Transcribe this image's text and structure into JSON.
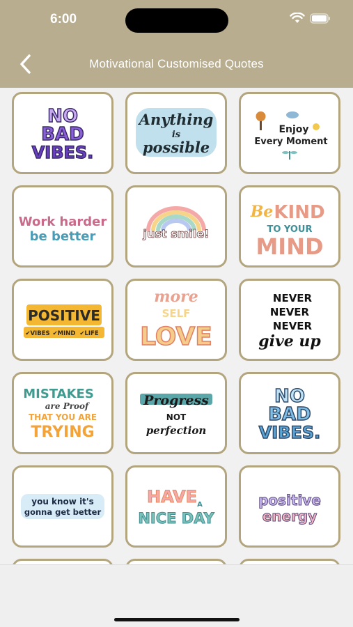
{
  "status_bar": {
    "time": "6:00"
  },
  "header": {
    "title": "Motivational Customised Quotes",
    "back_icon": "chevron-left-icon"
  },
  "stickers": [
    {
      "lines": [
        "NO",
        "BAD",
        "VIBES."
      ]
    },
    {
      "lines": [
        "Anything",
        "is",
        "possible"
      ]
    },
    {
      "lines": [
        "Enjoy",
        "Every Moment"
      ]
    },
    {
      "lines": [
        "Work harder",
        "be better"
      ]
    },
    {
      "lines": [
        "just smile!"
      ]
    },
    {
      "lines": [
        "Be",
        "KIND",
        "TO YOUR",
        "MIND"
      ]
    },
    {
      "lines": [
        "POSITIVE",
        "✔VIBES",
        "✔MIND",
        "✔LIFE"
      ]
    },
    {
      "lines": [
        "more",
        "SELF",
        "LOVE"
      ]
    },
    {
      "lines": [
        "NEVER",
        "NEVER",
        "NEVER",
        "give up"
      ]
    },
    {
      "lines": [
        "MISTAKES",
        "are Proof",
        "THAT YOU ARE",
        "TRYING"
      ]
    },
    {
      "lines": [
        "Progress",
        "NOT",
        "perfection"
      ]
    },
    {
      "lines": [
        "NO",
        "BAD",
        "VIBES."
      ]
    },
    {
      "lines": [
        "you know it's",
        "gonna get better"
      ]
    },
    {
      "lines": [
        "HAVE",
        "A",
        "NICE DAY"
      ]
    },
    {
      "lines": [
        "positive",
        "energy"
      ]
    }
  ],
  "colors": {
    "header": "#b9ad8f",
    "card_border": "#b3a57e"
  }
}
